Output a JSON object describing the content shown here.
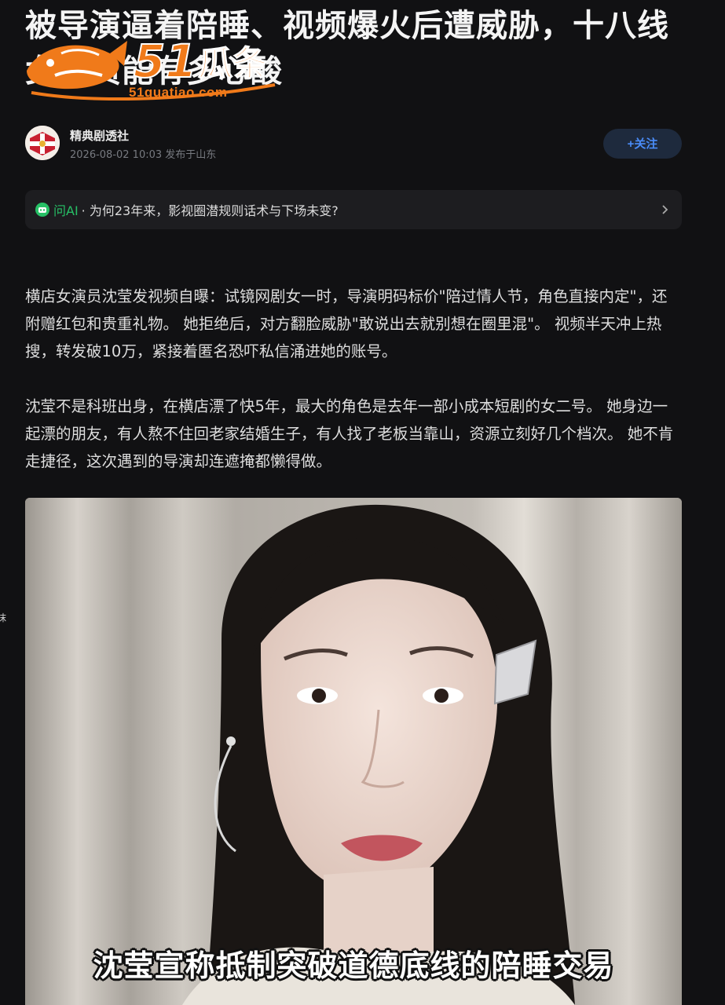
{
  "article": {
    "title": "被导演逼着陪睡、视频爆火后遭威胁，十八线女演员能有多心酸"
  },
  "watermark": {
    "logo_text": "51瓜条",
    "site_text": "51guatiao.com"
  },
  "author": {
    "name": "精典剧透社",
    "meta": "2026-08-02 10:03 发布于山东",
    "follow_label": "+关注"
  },
  "ai_bar": {
    "label": "问AI",
    "question": "· 为何23年来，影视圈潜规则话术与下场未变?"
  },
  "paragraphs": [
    "横店女演员沈莹发视频自曝：试镜网剧女一时，导演明码标价\"陪过情人节，角色直接内定\"，还附赠红包和贵重礼物。 她拒绝后，对方翻脸威胁\"敢说出去就别想在圈里混\"。 视频半天冲上热搜，转发破10万，紧接着匿名恐吓私信涌进她的账号。",
    "沈莹不是科班出身，在横店漂了快5年，最大的角色是去年一部小成本短剧的女二号。 她身边一起漂的朋友，有人熬不住回老家结婚生子，有人找了老板当靠山，资源立刻好几个档次。 她不肯走捷径，这次遇到的导演却连遮掩都懒得做。"
  ],
  "photo": {
    "caption": "沈莹宣称抵制突破道德底线的陪睡交易"
  },
  "edge": {
    "char": "抹"
  },
  "colors": {
    "background": "#111113",
    "follow_text": "#4a8cf7",
    "follow_bg": "#1e2a3d",
    "ai_green": "#27c066",
    "watermark_orange": "#f07a1a"
  }
}
